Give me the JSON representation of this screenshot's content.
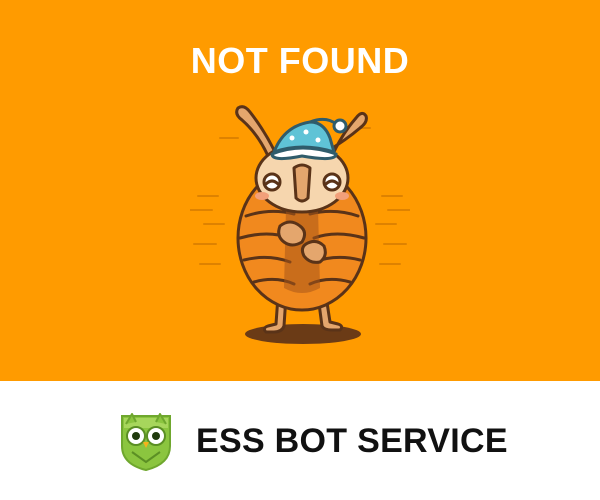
{
  "hero": {
    "title": "NOT FOUND",
    "background_color": "#FF9B00",
    "illustration": "sleepy-bug-icon"
  },
  "footer": {
    "brand_name": "ESS BOT SERVICE",
    "logo": "owl-shield-icon",
    "logo_color": "#8BC53F"
  }
}
